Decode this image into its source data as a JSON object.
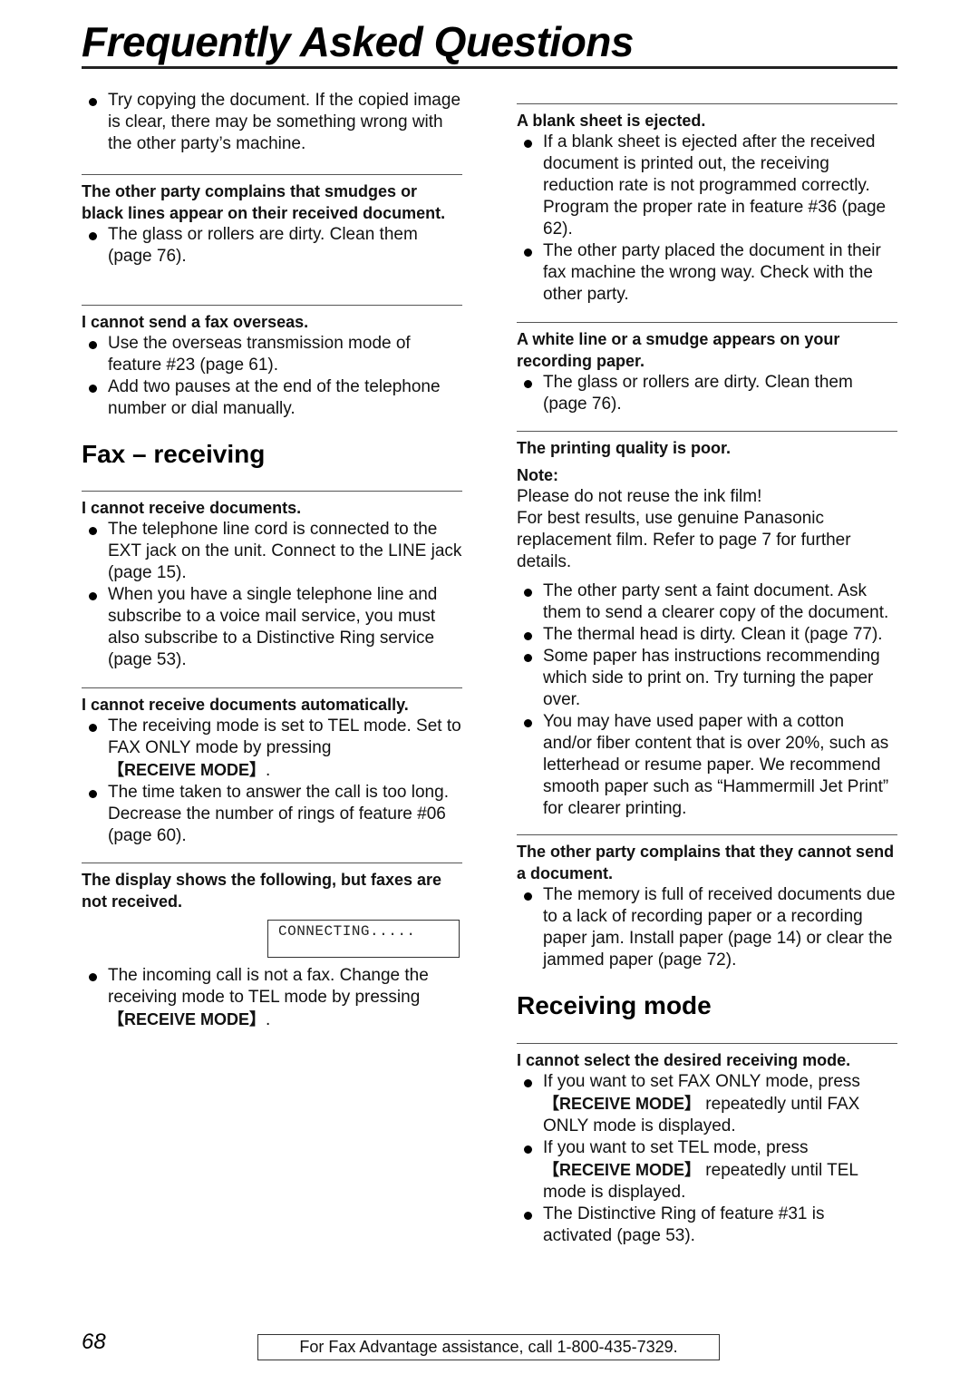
{
  "page": {
    "title": "Frequently Asked Questions",
    "page_number": "68",
    "footer": "For Fax Advantage assistance, call 1-800-435-7329."
  },
  "left": {
    "intro_items": [
      "Try copying the document. If the copied image is clear, there may be something wrong with the other party’s machine."
    ],
    "smudges": {
      "question": "The other party complains that smudges or black lines appear on their received document.",
      "items": [
        "The glass or rollers are dirty. Clean them (page 76)."
      ]
    },
    "overseas": {
      "question": "I cannot send a fax overseas.",
      "items": [
        "Use the overseas transmission mode of feature #23 (page 61).",
        "Add two pauses at the end of the telephone number or dial manually."
      ]
    },
    "section_fax_receiving": "Fax – receiving",
    "cannot_receive": {
      "question": "I cannot receive documents.",
      "items": [
        "The telephone line cord is connected to the EXT jack on the unit. Connect to the LINE jack (page 15).",
        "When you have a single telephone line and subscribe to a voice mail service, you must also subscribe to a Distinctive Ring service (page 53)."
      ]
    },
    "cannot_receive_auto": {
      "question": "I cannot receive documents automatically.",
      "item1_text": "The receiving mode is set to TEL mode. Set to FAX ONLY mode by pressing ",
      "item1_key": "【RECEIVE MODE】",
      "item1_end": ".",
      "item2": "The time taken to answer the call is too long. Decrease the number of rings of feature #06 (page 60)."
    },
    "display_shows": {
      "question": "The display shows the following, but faxes are not received.",
      "lcd": "CONNECTING.....",
      "item1_text": "The incoming call is not a fax. Change the receiving mode to TEL mode by pressing ",
      "item1_key": "【RECEIVE MODE】",
      "item1_end": "."
    }
  },
  "right": {
    "blank_sheet": {
      "question": "A blank sheet is ejected.",
      "items": [
        "If a blank sheet is ejected after the received document is printed out, the receiving reduction rate is not programmed correctly. Program the proper rate in feature #36 (page 62).",
        "The other party placed the document in their fax machine the wrong way. Check with the other party."
      ]
    },
    "white_line": {
      "question": "A white line or a smudge appears on your recording paper.",
      "items": [
        "The glass or rollers are dirty. Clean them (page 76)."
      ]
    },
    "print_quality": {
      "question": "The printing quality is poor.",
      "note_label": "Note:",
      "note_line1": "Please do not reuse the ink film!",
      "note_line2": "For best results, use genuine Panasonic replacement film. Refer to page 7 for further details.",
      "items": [
        "The other party sent a faint document. Ask them to send a clearer copy of the document.",
        "The thermal head is dirty. Clean it (page 77).",
        "Some paper has instructions recommending which side to print on. Try turning the paper over.",
        "You may have used paper with a cotton and/or fiber content that is over 20%, such as letterhead or resume paper. We recommend smooth paper such as “Hammermill Jet Print” for clearer printing."
      ]
    },
    "cannot_send": {
      "question": "The other party complains that they cannot send a document.",
      "items": [
        "The memory is full of received documents due to a lack of recording paper or a recording paper jam. Install paper (page 14) or clear the jammed paper (page 72)."
      ]
    },
    "section_receiving_mode": "Receiving mode",
    "select_mode": {
      "question": "I cannot select the desired receiving mode.",
      "item1_start": "If you want to set FAX ONLY mode, press ",
      "item1_key": "【RECEIVE MODE】",
      "item1_end": " repeatedly until FAX ONLY mode is displayed.",
      "item2_start": "If you want to set TEL mode, press ",
      "item2_key": "【RECEIVE MODE】",
      "item2_end": " repeatedly until TEL mode is displayed.",
      "item3": "The Distinctive Ring of feature #31 is activated (page 53)."
    }
  }
}
